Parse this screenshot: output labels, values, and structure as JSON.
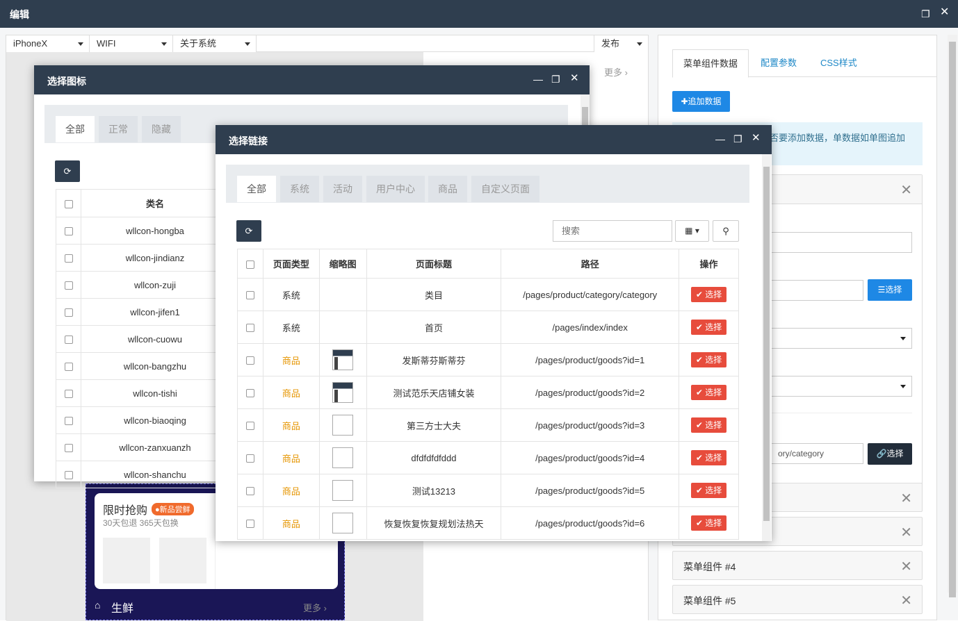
{
  "window": {
    "title": "编辑"
  },
  "toolbar": {
    "device": "iPhoneX",
    "network": "WIFI",
    "page": "关于系统",
    "publish": "发布"
  },
  "mid": {
    "more1": "更多 ›"
  },
  "right": {
    "tabs": [
      "菜单组件数据",
      "配置参数",
      "CSS样式"
    ],
    "add_btn": "✚追加数据",
    "info": "否要添加数据，单数据如单图追加",
    "select_btn": "☰选择",
    "path_value": "ory/category",
    "link_btn": "🔗选择",
    "cards": [
      "菜单组件 #4",
      "菜单组件 #5"
    ],
    "close": "✕"
  },
  "icon_dialog": {
    "title": "选择图标",
    "tabs": [
      "全部",
      "正常",
      "隐藏"
    ],
    "col": "类名",
    "rows": [
      "wllcon-hongba",
      "wllcon-jindianz",
      "wllcon-zuji",
      "wllcon-jifen1",
      "wllcon-cuowu",
      "wllcon-bangzhu",
      "wllcon-tishi",
      "wllcon-biaoqing",
      "wllcon-zanxuanzh",
      "wllcon-shanchu"
    ]
  },
  "link_dialog": {
    "title": "选择链接",
    "tabs": [
      "全部",
      "系统",
      "活动",
      "用户中心",
      "商品",
      "自定义页面"
    ],
    "search_placeholder": "搜索",
    "cols": [
      "页面类型",
      "缩略图",
      "页面标题",
      "路径",
      "操作"
    ],
    "pick": "✔ 选择",
    "rows": [
      {
        "type": "系统",
        "thumb": "none",
        "title": "类目",
        "path": "/pages/product/category/category"
      },
      {
        "type": "系统",
        "thumb": "none",
        "title": "首页",
        "path": "/pages/index/index"
      },
      {
        "type": "商品",
        "thumb": "real",
        "title": "发斯蒂芬斯蒂芬",
        "path": "/pages/product/goods?id=1"
      },
      {
        "type": "商品",
        "thumb": "real",
        "title": "测试范乐天店铺女装",
        "path": "/pages/product/goods?id=2"
      },
      {
        "type": "商品",
        "thumb": "broken",
        "title": "第三方士大夫",
        "path": "/pages/product/goods?id=3"
      },
      {
        "type": "商品",
        "thumb": "broken",
        "title": "dfdfdfdfddd",
        "path": "/pages/product/goods?id=4"
      },
      {
        "type": "商品",
        "thumb": "broken",
        "title": "测试13213",
        "path": "/pages/product/goods?id=5"
      },
      {
        "type": "商品",
        "thumb": "broken",
        "title": "恢复恢复恢复规划法热天",
        "path": "/pages/product/goods?id=6"
      }
    ]
  },
  "phone": {
    "flash_title": "限时抢购",
    "badge": "●新品尝鲜",
    "sub": "30天包退 365天包换",
    "fresh": "生鲜",
    "fresh_more": "更多 ›"
  }
}
